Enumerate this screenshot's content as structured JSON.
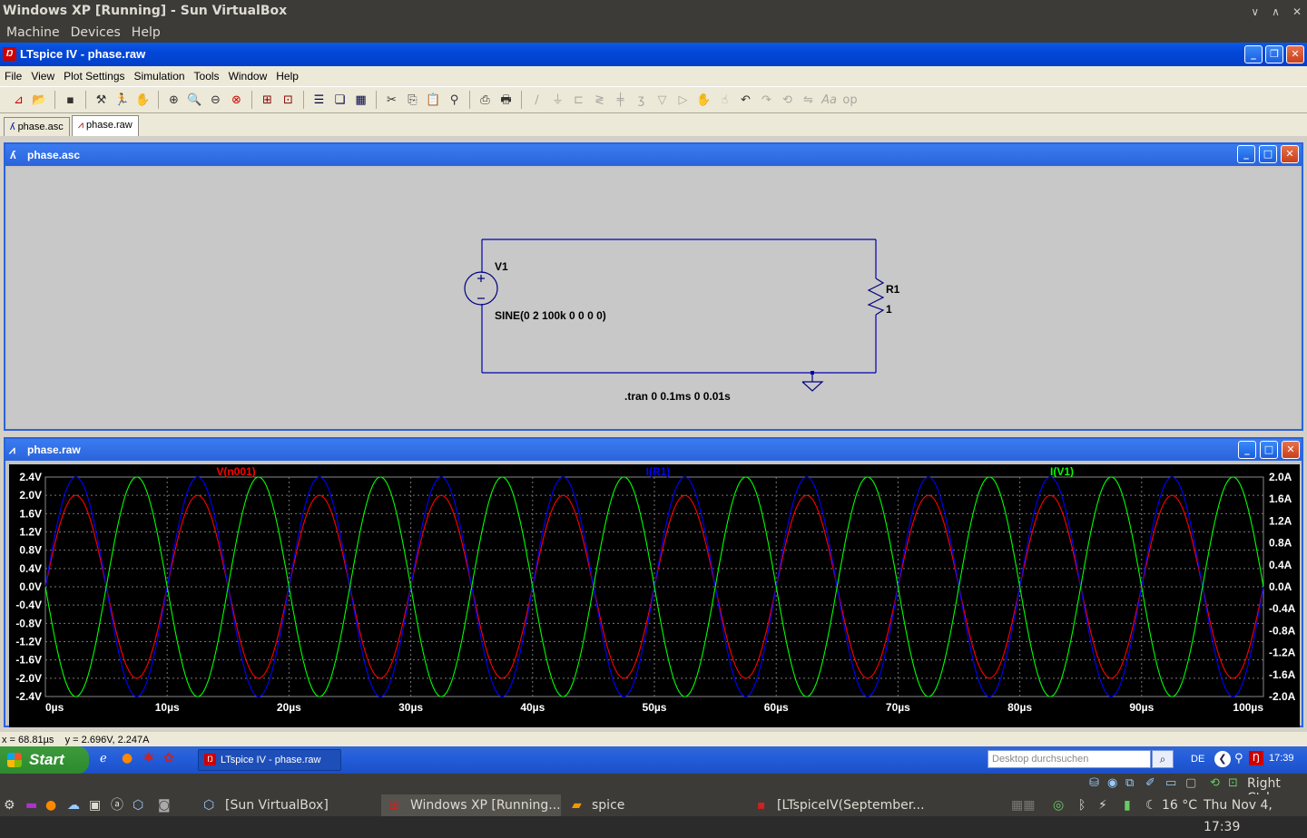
{
  "host": {
    "window_title": "Windows XP [Running] - Sun VirtualBox",
    "menu": [
      "Machine",
      "Devices",
      "Help"
    ]
  },
  "app": {
    "title": "LTspice IV - phase.raw",
    "menu": [
      "File",
      "View",
      "Plot Settings",
      "Simulation",
      "Tools",
      "Window",
      "Help"
    ],
    "tabs": [
      "phase.asc",
      "phase.raw"
    ]
  },
  "schematic": {
    "title": "phase.asc",
    "source_name": "V1",
    "source_value": "SINE(0 2 100k 0 0 0 0)",
    "resistor_name": "R1",
    "resistor_value": "1",
    "directive": ".tran 0 0.1ms 0 0.01s"
  },
  "plot": {
    "title": "phase.raw"
  },
  "chart_data": {
    "type": "line",
    "xlabel": "",
    "ylabel": "",
    "x_range": [
      0,
      100
    ],
    "x_unit": "µs",
    "x_ticks": [
      "0µs",
      "10µs",
      "20µs",
      "30µs",
      "40µs",
      "50µs",
      "60µs",
      "70µs",
      "80µs",
      "90µs",
      "100µs"
    ],
    "y_left_ticks": [
      "2.4V",
      "2.0V",
      "1.6V",
      "1.2V",
      "0.8V",
      "0.4V",
      "0.0V",
      "-0.4V",
      "-0.8V",
      "-1.2V",
      "-1.6V",
      "-2.0V",
      "-2.4V"
    ],
    "y_left_range": [
      -2.4,
      2.4
    ],
    "y_right_ticks": [
      "2.0A",
      "1.6A",
      "1.2A",
      "0.8A",
      "0.4A",
      "0.0A",
      "-0.4A",
      "-0.8A",
      "-1.2A",
      "-1.6A",
      "-2.0A"
    ],
    "y_right_range": [
      -2.0,
      2.0
    ],
    "grid": true,
    "series": [
      {
        "name": "V(n001)",
        "color": "#ff0000",
        "axis": "left",
        "amplitude": 2.0,
        "frequency_hz": 100000,
        "phase_deg": 0
      },
      {
        "name": "I(R1)",
        "color": "#0000ff",
        "axis": "right",
        "amplitude": 2.0,
        "frequency_hz": 100000,
        "phase_deg": 0
      },
      {
        "name": "I(V1)",
        "color": "#00ff00",
        "axis": "right",
        "amplitude": 2.0,
        "frequency_hz": 100000,
        "phase_deg": 180
      }
    ]
  },
  "status_bar": "x = 68.81µs    y = 2.696V, 2.247A",
  "xp_taskbar": {
    "start_label": "Start",
    "task": "LTspice IV - phase.raw",
    "search_placeholder": "Desktop durchsuchen",
    "lang": "DE",
    "clock": "17:39",
    "right_ctrl": "Right Ctrl"
  },
  "ubuntu_panel": {
    "items": [
      "[Sun VirtualBox]",
      "Windows XP [Running...",
      "spice",
      "[LTspiceIV(September..."
    ],
    "temperature": "16 °C",
    "datetime": "Thu Nov 4, 17:39"
  }
}
